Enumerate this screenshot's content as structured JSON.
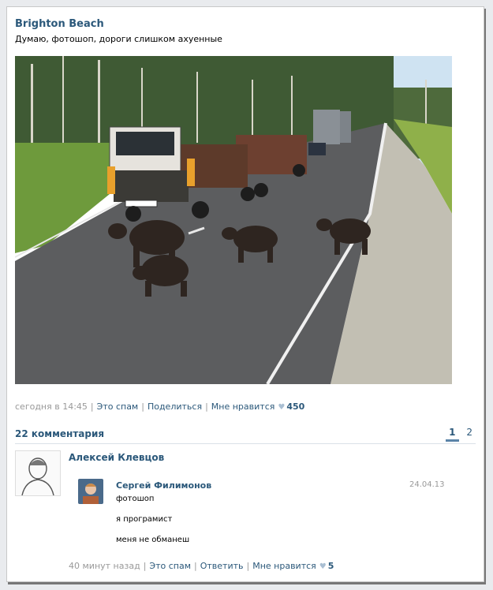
{
  "post": {
    "author": "Brighton Beach",
    "text": "Думаю, фотошоп, дороги слишком ахуенные",
    "meta": {
      "time": "сегодня в 14:45",
      "spam": "Это спам",
      "share": "Поделиться",
      "like": "Мне нравится",
      "likes_count": "450"
    }
  },
  "comments_header": {
    "count_label": "22 комментария",
    "pages": [
      "1",
      "2"
    ]
  },
  "comment1": {
    "author": "Алексей Клевцов"
  },
  "comment2": {
    "author": "Сергей Филимонов",
    "date": "24.04.13",
    "lines": [
      "фотошоп",
      "я програмист",
      "меня не обманеш"
    ]
  },
  "comment_meta": {
    "time": "40 минут назад",
    "spam": "Это спам",
    "reply": "Ответить",
    "like": "Мне нравится",
    "likes_count": "5"
  },
  "colors": {
    "link": "#2b587a",
    "muted": "#999999",
    "heart": "#a9bed2"
  }
}
